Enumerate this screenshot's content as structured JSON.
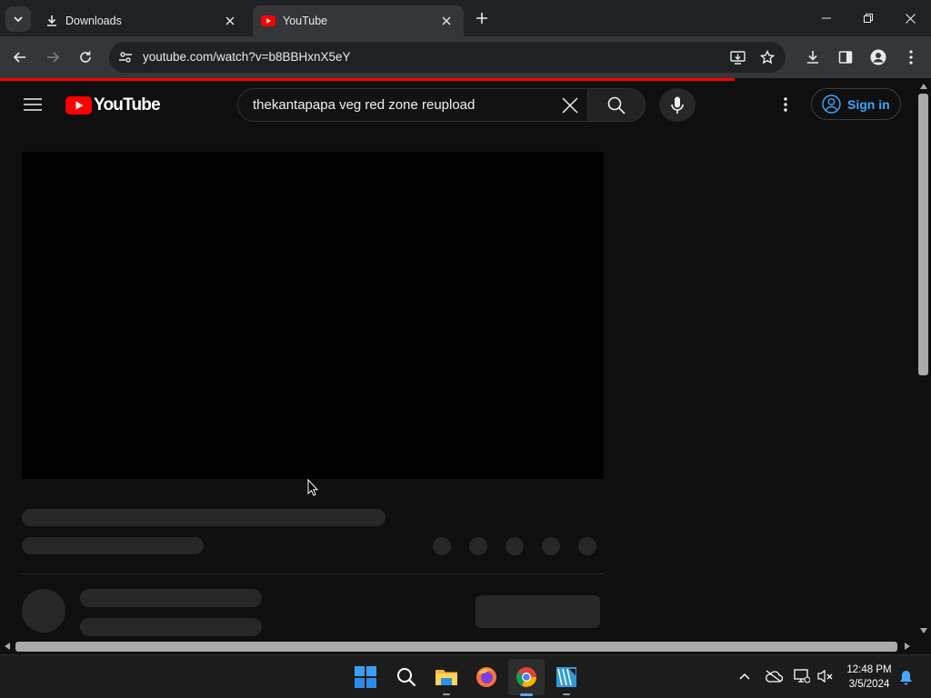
{
  "browser": {
    "tabs": [
      {
        "title": "Downloads",
        "active": false
      },
      {
        "title": "YouTube",
        "active": true
      }
    ],
    "url": "youtube.com/watch?v=b8BBHxnX5eY"
  },
  "youtube": {
    "logo_text": "YouTube",
    "search_query": "thekantapapa veg red zone reupload",
    "signin_label": "Sign in"
  },
  "taskbar": {
    "time": "12:48 PM",
    "date": "3/5/2024"
  },
  "colors": {
    "yt_red": "#ff0000",
    "link_blue": "#3ea6ff",
    "background": "#0f0f0f"
  }
}
